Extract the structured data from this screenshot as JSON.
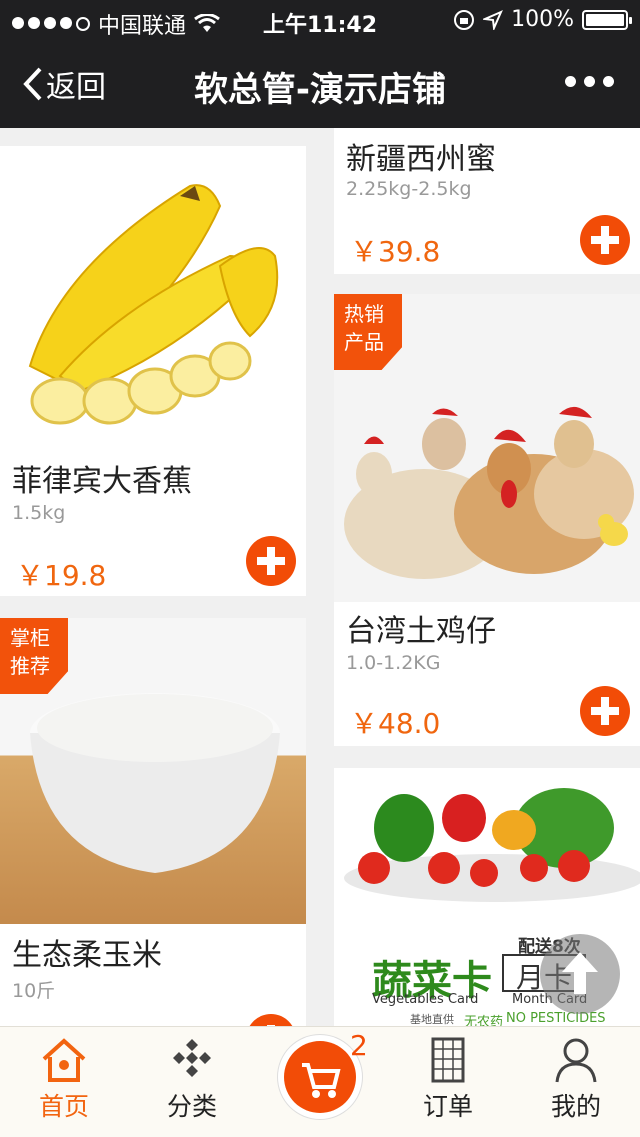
{
  "status_bar": {
    "carrier": "中国联通",
    "time": "上午11:42",
    "battery": "100%"
  },
  "header": {
    "back_label": "返回",
    "title": "软总管-演示店铺"
  },
  "products": [
    {
      "name": "新疆西州蜜",
      "spec": "2.25kg-2.5kg",
      "price": "￥39.8",
      "tag": ""
    },
    {
      "name": "菲律宾大香蕉",
      "spec": "1.5kg",
      "price": "￥19.8",
      "tag": ""
    },
    {
      "name": "台湾土鸡仔",
      "spec": "1.0-1.2KG",
      "price": "￥48.0",
      "tag": "热销 产品"
    },
    {
      "name": "生态柔玉米",
      "spec": "10斤",
      "price": "",
      "tag": "掌柜 推荐"
    },
    {
      "name": "",
      "spec": "",
      "price": "",
      "tag": ""
    }
  ],
  "tags": {
    "hot_line1": "热销",
    "hot_line2": "产品",
    "rec_line1": "掌柜",
    "rec_line2": "推荐"
  },
  "veg_card": {
    "title": "蔬菜卡",
    "subtitle": "Vegetables Card",
    "delivery": "配送8次",
    "month": "月卡",
    "month_en": "Month Card",
    "no_pesticide": "无农药",
    "no_pesticide_en": "NO PESTICIDES",
    "base": "基地直供"
  },
  "tabbar": {
    "home": "首页",
    "category": "分类",
    "orders": "订单",
    "mine": "我的",
    "cart_count": "2"
  },
  "colors": {
    "accent": "#f24c07",
    "price": "#f0660f",
    "header_bg": "#1f1f21"
  }
}
